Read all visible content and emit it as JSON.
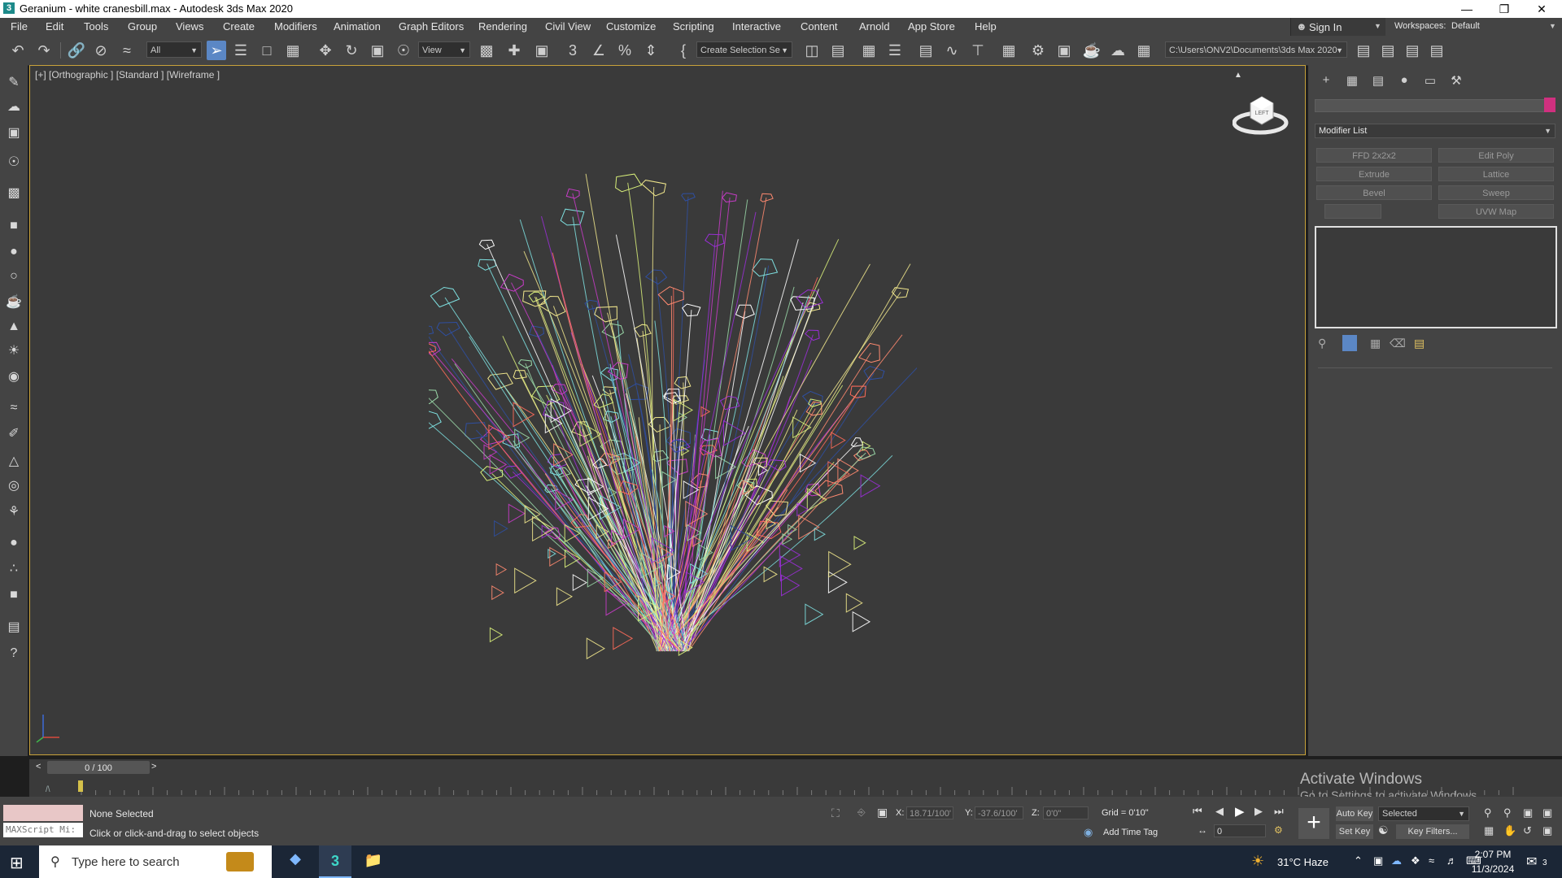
{
  "window": {
    "title": "Geranium - white cranesbill.max - Autodesk 3ds Max 2020",
    "app_icon": "3"
  },
  "menu": [
    "File",
    "Edit",
    "Tools",
    "Group",
    "Views",
    "Create",
    "Modifiers",
    "Animation",
    "Graph Editors",
    "Rendering",
    "Civil View",
    "Customize",
    "Scripting",
    "Interactive",
    "Content",
    "Arnold",
    "App Store",
    "Help"
  ],
  "signin": {
    "label": "Sign In"
  },
  "workspace": {
    "label": "Workspaces:",
    "value": "Default"
  },
  "toolbar": {
    "filter_value": "All",
    "refcoord_value": "View",
    "selection_set_value": "Create Selection Se",
    "project_path": "C:\\Users\\ONV2\\Documents\\3ds Max 2020"
  },
  "viewport": {
    "label": "[+] [Orthographic ] [Standard ] [Wireframe ]",
    "viewcube_face": "LEFT"
  },
  "command_panel": {
    "modifier_list_label": "Modifier List",
    "modifier_buttons": [
      "FFD 2x2x2",
      "Edit Poly",
      "Extrude",
      "Lattice",
      "Bevel",
      "Sweep",
      "",
      "UVW Map"
    ],
    "color_swatch": "#d0307f"
  },
  "timeline": {
    "frame_label": "0 / 100",
    "prev": "<",
    "next": ">"
  },
  "status": {
    "selection": "None Selected",
    "prompt": "Click or click-and-drag to select objects",
    "maxscript_label": "MAXScript Mi:",
    "x_label": "X:",
    "x_value": "18.71/100'",
    "y_label": "Y:",
    "y_value": "-37.6/100'",
    "z_label": "Z:",
    "z_value": "0'0\"",
    "grid": "Grid = 0'10\"",
    "add_time_tag": "Add Time Tag",
    "auto_key": "Auto Key",
    "set_key": "Set Key",
    "key_mode_value": "Selected",
    "key_filters": "Key Filters...",
    "frame_value": "0"
  },
  "activate_windows": {
    "line1": "Activate Windows",
    "line2": "Go to Settings to activate Windows."
  },
  "taskbar": {
    "search_placeholder": "Type here to search",
    "weather": "31°C  Haze",
    "time": "2:07 PM",
    "date": "11/3/2024",
    "notifications": "3"
  },
  "wireframe_colors": [
    "#f0e68c",
    "#9ad8a8",
    "#7ee0e0",
    "#ff6b5a",
    "#2f4fa0",
    "#9a2fd6",
    "#c83cc8",
    "#ffffff",
    "#ff8a70",
    "#d9f07a"
  ]
}
